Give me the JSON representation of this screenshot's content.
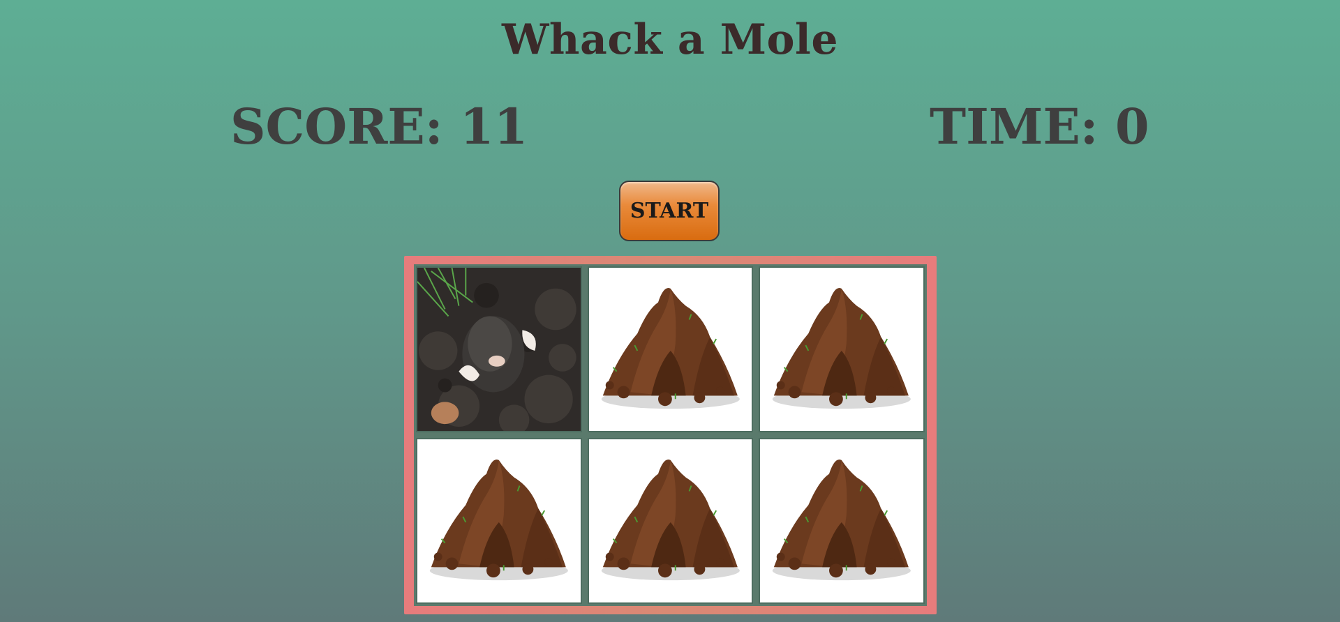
{
  "title": "Whack a Mole",
  "score_text": "SCORE: 11",
  "time_text": "TIME: 0",
  "start_label": "START",
  "holes": [
    {
      "state": "mole",
      "icon": "mole-image"
    },
    {
      "state": "empty",
      "icon": "dirt-mound-icon"
    },
    {
      "state": "empty",
      "icon": "dirt-mound-icon"
    },
    {
      "state": "empty",
      "icon": "dirt-mound-icon"
    },
    {
      "state": "empty",
      "icon": "dirt-mound-icon"
    },
    {
      "state": "empty",
      "icon": "dirt-mound-icon"
    }
  ],
  "colors": {
    "board_border": "#e77c7c",
    "start_button": "#e07820",
    "mound": "#6b3a1e"
  }
}
